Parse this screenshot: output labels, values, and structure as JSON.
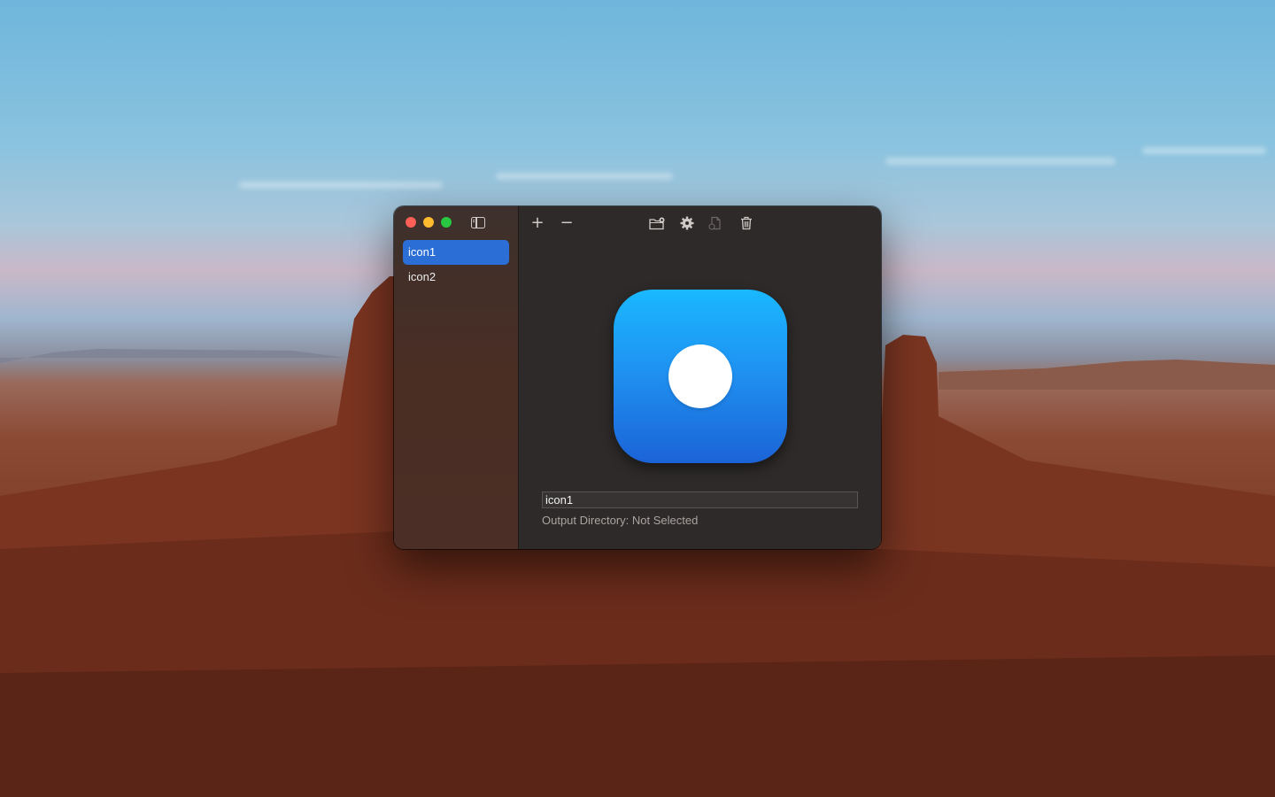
{
  "window": {
    "sidebar": {
      "items": [
        {
          "label": "icon1",
          "selected": true
        },
        {
          "label": "icon2",
          "selected": false
        }
      ]
    },
    "toolbar": {
      "add_label": "+",
      "remove_label": "−",
      "icons": [
        "folder-badge-icon",
        "gear-icon",
        "export-document-icon",
        "trash-icon"
      ]
    },
    "editor": {
      "name_value": "icon1",
      "output_directory": "Output Directory: Not Selected",
      "icon_gradient": [
        "#1ab8ff",
        "#1b63d7"
      ]
    }
  },
  "colors": {
    "accent": "#2b6fd6",
    "close": "#fe5f57",
    "minimize": "#febc2e",
    "zoom": "#28c840"
  }
}
